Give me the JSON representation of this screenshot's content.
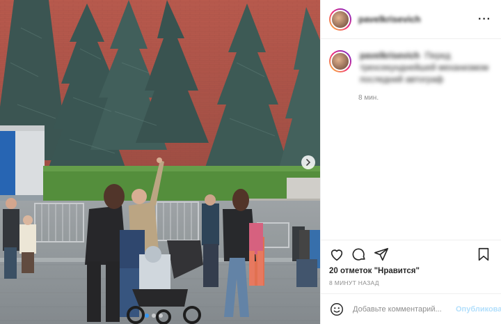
{
  "post": {
    "username": "pavelkrisevich",
    "caption_username": "pavelkrisevich",
    "caption_text": "Перед трехсекунднейшей механизмом последний автограф",
    "caption_time": "8 мин."
  },
  "actions": {
    "like_icon": "heart-icon",
    "comment_icon": "comment-icon",
    "share_icon": "paper-plane-icon",
    "save_icon": "bookmark-icon",
    "likes_text": "20 отметок \"Нравится\"",
    "posted_time": "8 минут назад"
  },
  "comment_box": {
    "placeholder": "Добавьте комментарий...",
    "publish_label": "Опубликовать"
  },
  "colors": {
    "accent": "#3897f0",
    "publish_disabled": "#b2dffc",
    "muted": "#8e8e8e"
  }
}
